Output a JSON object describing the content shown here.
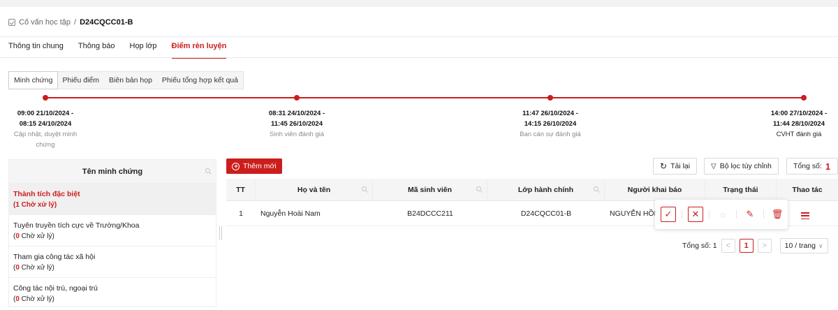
{
  "breadcrumb": {
    "parent": "Cố vấn học tập",
    "separator": "/",
    "current": "D24CQCC01-B"
  },
  "tabs": [
    "Thông tin chung",
    "Thông báo",
    "Họp lớp",
    "Điểm rèn luyện"
  ],
  "active_tab": "Điểm rèn luyện",
  "subtabs": [
    "Minh chứng",
    "Phiếu điểm",
    "Biên bản họp",
    "Phiếu tổng hợp kết quả"
  ],
  "active_subtab": "Minh chứng",
  "timeline": [
    {
      "start": "09:00 21/10/2024 -",
      "end": "08:15 24/10/2024",
      "label_line1": "Cập nhật, duyệt minh",
      "label_line2": "chứng"
    },
    {
      "start": "08:31 24/10/2024 -",
      "end": "11:45 26/10/2024",
      "label_line1": "Sinh viên đánh giá",
      "label_line2": ""
    },
    {
      "start": "11:47 26/10/2024 -",
      "end": "14:15 26/10/2024",
      "label_line1": "Ban cán sự đánh giá",
      "label_line2": ""
    },
    {
      "start": "14:00 27/10/2024 -",
      "end": "11:44 28/10/2024",
      "label_line1": "CVHT đánh giá",
      "label_line2": ""
    }
  ],
  "left_panel": {
    "header": "Tên minh chứng",
    "items": [
      {
        "name": "Thành tích đặc biệt",
        "count_prefix": "(",
        "count": "1",
        "count_suffix": " Chờ xử lý)"
      },
      {
        "name": "Tuyên truyền tích cực về Trường/Khoa",
        "count_prefix": "(",
        "count": "0",
        "count_suffix": " Chờ xử lý)"
      },
      {
        "name": "Tham gia công tác xã hội",
        "count_prefix": "(",
        "count": "0",
        "count_suffix": " Chờ xử lý)"
      },
      {
        "name": "Công tác nội trú, ngoại trú",
        "count_prefix": "(",
        "count": "0",
        "count_suffix": " Chờ xử lý)"
      }
    ]
  },
  "toolbar": {
    "add_label": "Thêm mới",
    "reload_label": "Tải lại",
    "filter_label": "Bộ lọc tùy chỉnh",
    "total_label": "Tổng số:",
    "total_value": "1"
  },
  "table": {
    "columns": [
      "TT",
      "Họ và tên",
      "Mã sinh viên",
      "Lớp hành chính",
      "Người khai báo",
      "Trạng thái",
      "Thao tác"
    ],
    "rows": [
      {
        "tt": "1",
        "name": "Nguyễn Hoài Nam",
        "msv": "B24DCCC211",
        "lhc": "D24CQCC01-B",
        "nkb": "NGUYỄN HỒNG AN",
        "status": ""
      }
    ]
  },
  "pagination": {
    "total_label": "Tổng số: 1",
    "prev": "<",
    "page": "1",
    "next": ">",
    "page_size": "10 / trang"
  },
  "colors": {
    "accent": "#cc1d1d"
  }
}
